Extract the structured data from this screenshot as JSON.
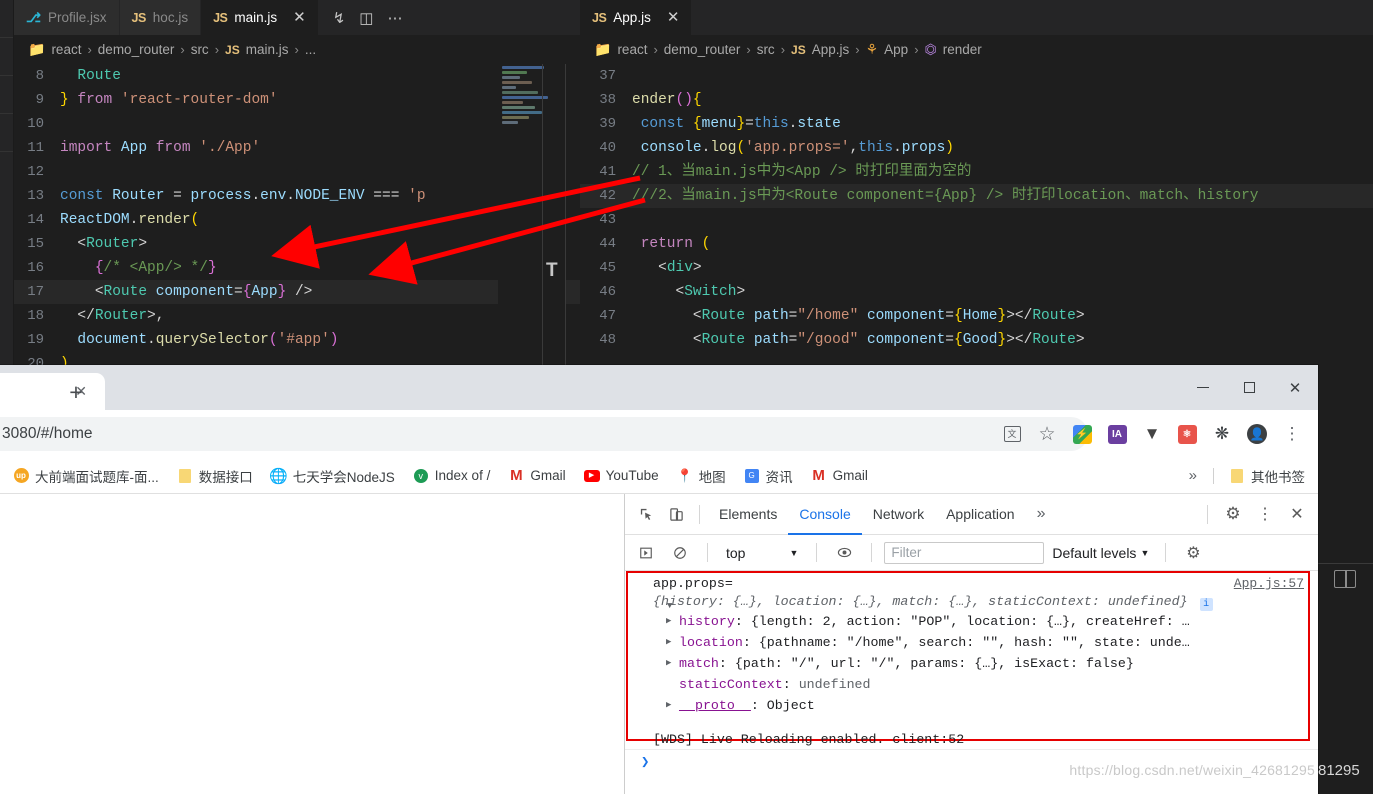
{
  "vscode": {
    "left_tabs": [
      {
        "icon": "jsx-icon",
        "icon_text": "⎇",
        "label": "Profile.jsx",
        "active": false
      },
      {
        "icon": "js-icon",
        "icon_text": "JS",
        "label": "hoc.js",
        "active": false
      },
      {
        "icon": "js-icon",
        "icon_text": "JS",
        "label": "main.js",
        "active": true,
        "close": "✕"
      }
    ],
    "left_tab_actions": [
      "source-control-icon",
      "split-editor-icon",
      "more-actions-icon"
    ],
    "left_breadcrumb": [
      "react",
      "demo_router",
      "src",
      "main.js",
      "..."
    ],
    "right_tabs": [
      {
        "icon": "js-icon",
        "icon_text": "JS",
        "label": "App.js",
        "active": true,
        "close": "✕"
      }
    ],
    "right_breadcrumb": [
      "react",
      "demo_router",
      "src",
      "App.js",
      "App",
      "render"
    ],
    "left_code": [
      {
        "n": "8",
        "tokens": [
          {
            "c": "t-tag",
            "t": "  Route"
          }
        ]
      },
      {
        "n": "9",
        "tokens": [
          {
            "c": "t-brace-y",
            "t": "} "
          },
          {
            "c": "t-key",
            "t": "from"
          },
          {
            "c": "t-str",
            "t": " 'react-router-dom'"
          }
        ]
      },
      {
        "n": "10",
        "tokens": [
          {
            "c": "t-plain",
            "t": ""
          }
        ]
      },
      {
        "n": "11",
        "tokens": [
          {
            "c": "t-key",
            "t": "import"
          },
          {
            "c": "t-var",
            "t": " App "
          },
          {
            "c": "t-key",
            "t": "from"
          },
          {
            "c": "t-str",
            "t": " './App'"
          }
        ]
      },
      {
        "n": "12",
        "tokens": [
          {
            "c": "t-plain",
            "t": ""
          }
        ]
      },
      {
        "n": "13",
        "tokens": [
          {
            "c": "t-kw2",
            "t": "const"
          },
          {
            "c": "t-var",
            "t": " Router "
          },
          {
            "c": "t-plain",
            "t": "= "
          },
          {
            "c": "t-var",
            "t": "process"
          },
          {
            "c": "t-plain",
            "t": "."
          },
          {
            "c": "t-var",
            "t": "env"
          },
          {
            "c": "t-plain",
            "t": "."
          },
          {
            "c": "t-var",
            "t": "NODE_ENV"
          },
          {
            "c": "t-plain",
            "t": " === "
          },
          {
            "c": "t-str",
            "t": "'p"
          }
        ]
      },
      {
        "n": "14",
        "tokens": [
          {
            "c": "t-var",
            "t": "ReactDOM"
          },
          {
            "c": "t-plain",
            "t": "."
          },
          {
            "c": "t-fn",
            "t": "render"
          },
          {
            "c": "t-brace-y",
            "t": "("
          }
        ]
      },
      {
        "n": "15",
        "tokens": [
          {
            "c": "t-plain",
            "t": "  "
          },
          {
            "c": "t-punc",
            "t": "<"
          },
          {
            "c": "t-tag",
            "t": "Router"
          },
          {
            "c": "t-punc",
            "t": ">"
          }
        ]
      },
      {
        "n": "16",
        "tokens": [
          {
            "c": "t-plain",
            "t": "    "
          },
          {
            "c": "t-brace-p",
            "t": "{"
          },
          {
            "c": "t-com",
            "t": "/* <App/> */"
          },
          {
            "c": "t-brace-p",
            "t": "}"
          }
        ]
      },
      {
        "n": "17",
        "tokens": [
          {
            "c": "t-plain",
            "t": "    "
          },
          {
            "c": "t-punc",
            "t": "<"
          },
          {
            "c": "t-tag",
            "t": "Route"
          },
          {
            "c": "t-var",
            "t": " component"
          },
          {
            "c": "t-plain",
            "t": "="
          },
          {
            "c": "t-brace-p",
            "t": "{"
          },
          {
            "c": "t-var",
            "t": "App"
          },
          {
            "c": "t-brace-p",
            "t": "}"
          },
          {
            "c": "t-punc",
            "t": " />"
          }
        ],
        "hl": true
      },
      {
        "n": "18",
        "tokens": [
          {
            "c": "t-plain",
            "t": "  "
          },
          {
            "c": "t-punc",
            "t": "</"
          },
          {
            "c": "t-tag",
            "t": "Router"
          },
          {
            "c": "t-punc",
            "t": ">,"
          }
        ]
      },
      {
        "n": "19",
        "tokens": [
          {
            "c": "t-plain",
            "t": "  "
          },
          {
            "c": "t-var",
            "t": "document"
          },
          {
            "c": "t-plain",
            "t": "."
          },
          {
            "c": "t-fn",
            "t": "querySelector"
          },
          {
            "c": "t-brace-p",
            "t": "("
          },
          {
            "c": "t-str",
            "t": "'#app'"
          },
          {
            "c": "t-brace-p",
            "t": ")"
          }
        ]
      },
      {
        "n": "20",
        "tokens": [
          {
            "c": "t-brace-y",
            "t": ")"
          }
        ]
      }
    ],
    "right_code": [
      {
        "n": "37",
        "tokens": [
          {
            "c": "t-plain",
            "t": ""
          }
        ]
      },
      {
        "n": "38",
        "tokens": [
          {
            "c": "t-fn",
            "t": "ender"
          },
          {
            "c": "t-brace-p",
            "t": "()"
          },
          {
            "c": "t-brace-y",
            "t": "{"
          }
        ]
      },
      {
        "n": "39",
        "tokens": [
          {
            "c": "t-plain",
            "t": " "
          },
          {
            "c": "t-kw2",
            "t": "const"
          },
          {
            "c": "t-brace-y",
            "t": " {"
          },
          {
            "c": "t-var",
            "t": "menu"
          },
          {
            "c": "t-brace-y",
            "t": "}"
          },
          {
            "c": "t-plain",
            "t": "="
          },
          {
            "c": "t-kw2",
            "t": "this"
          },
          {
            "c": "t-plain",
            "t": "."
          },
          {
            "c": "t-var",
            "t": "state"
          }
        ]
      },
      {
        "n": "40",
        "tokens": [
          {
            "c": "t-plain",
            "t": " "
          },
          {
            "c": "t-var",
            "t": "console"
          },
          {
            "c": "t-plain",
            "t": "."
          },
          {
            "c": "t-fn",
            "t": "log"
          },
          {
            "c": "t-brace-y",
            "t": "("
          },
          {
            "c": "t-str",
            "t": "'app.props='"
          },
          {
            "c": "t-plain",
            "t": ","
          },
          {
            "c": "t-kw2",
            "t": "this"
          },
          {
            "c": "t-plain",
            "t": "."
          },
          {
            "c": "t-var",
            "t": "props"
          },
          {
            "c": "t-brace-y",
            "t": ")"
          }
        ]
      },
      {
        "n": "41",
        "tokens": [
          {
            "c": "t-com",
            "t": "// 1、当main.js中为<App /> 时打印里面为空的"
          }
        ]
      },
      {
        "n": "42",
        "tokens": [
          {
            "c": "t-com",
            "t": "///2、当main.js中为<Route component={App} /> 时打印location、match、history"
          }
        ],
        "hl": true
      },
      {
        "n": "43",
        "tokens": [
          {
            "c": "t-plain",
            "t": ""
          }
        ]
      },
      {
        "n": "44",
        "tokens": [
          {
            "c": "t-plain",
            "t": " "
          },
          {
            "c": "t-key",
            "t": "return"
          },
          {
            "c": "t-brace-y",
            "t": " ("
          }
        ]
      },
      {
        "n": "45",
        "tokens": [
          {
            "c": "t-plain",
            "t": "   "
          },
          {
            "c": "t-punc",
            "t": "<"
          },
          {
            "c": "t-tag",
            "t": "div"
          },
          {
            "c": "t-punc",
            "t": ">"
          }
        ]
      },
      {
        "n": "46",
        "tokens": [
          {
            "c": "t-plain",
            "t": "     "
          },
          {
            "c": "t-punc",
            "t": "<"
          },
          {
            "c": "t-tag",
            "t": "Switch"
          },
          {
            "c": "t-punc",
            "t": ">"
          }
        ]
      },
      {
        "n": "47",
        "tokens": [
          {
            "c": "t-plain",
            "t": "       "
          },
          {
            "c": "t-punc",
            "t": "<"
          },
          {
            "c": "t-tag",
            "t": "Route"
          },
          {
            "c": "t-var",
            "t": " path"
          },
          {
            "c": "t-plain",
            "t": "="
          },
          {
            "c": "t-str",
            "t": "\"/home\""
          },
          {
            "c": "t-var",
            "t": " component"
          },
          {
            "c": "t-plain",
            "t": "="
          },
          {
            "c": "t-brace-y",
            "t": "{"
          },
          {
            "c": "t-var",
            "t": "Home"
          },
          {
            "c": "t-brace-y",
            "t": "}"
          },
          {
            "c": "t-punc",
            "t": "></"
          },
          {
            "c": "t-tag",
            "t": "Route"
          },
          {
            "c": "t-punc",
            "t": ">"
          }
        ]
      },
      {
        "n": "48",
        "tokens": [
          {
            "c": "t-plain",
            "t": "       "
          },
          {
            "c": "t-punc",
            "t": "<"
          },
          {
            "c": "t-tag",
            "t": "Route"
          },
          {
            "c": "t-var",
            "t": " path"
          },
          {
            "c": "t-plain",
            "t": "="
          },
          {
            "c": "t-str",
            "t": "\"/good\""
          },
          {
            "c": "t-var",
            "t": " component"
          },
          {
            "c": "t-plain",
            "t": "="
          },
          {
            "c": "t-brace-y",
            "t": "{"
          },
          {
            "c": "t-var",
            "t": "Good"
          },
          {
            "c": "t-brace-y",
            "t": "}"
          },
          {
            "c": "t-punc",
            "t": "></"
          },
          {
            "c": "t-tag",
            "t": "Route"
          },
          {
            "c": "t-punc",
            "t": ">"
          }
        ]
      }
    ],
    "minimap_marker": "T"
  },
  "chrome": {
    "tab_close": "✕",
    "new_tab": "+",
    "window_controls": {
      "minimize": "minimize-icon",
      "maximize": "maximize-icon",
      "close": "✕"
    },
    "url": "3080/#/home",
    "toolbar_icons": [
      "translate-icon",
      "bookmark-star-icon",
      "extension-colorful-icon",
      "ia-extension-icon",
      "v-extension-icon",
      "react-devtools-icon",
      "extensions-puzzle-icon",
      "profile-avatar-icon",
      "chrome-menu-icon"
    ],
    "bookmarks": [
      {
        "icon": "up-favicon",
        "glyph": "up",
        "label": "大前端面试题库-面..."
      },
      {
        "icon": "folder-icon",
        "glyph": "▮",
        "label": "数据接口"
      },
      {
        "icon": "globe-icon",
        "glyph": "⊕",
        "label": "七天学会NodeJS"
      },
      {
        "icon": "v-favicon",
        "glyph": "v",
        "label": "Index of /"
      },
      {
        "icon": "gmail-icon",
        "glyph": "M",
        "label": "Gmail"
      },
      {
        "icon": "youtube-icon",
        "glyph": "▶",
        "label": "YouTube"
      },
      {
        "icon": "maps-icon",
        "glyph": "📍",
        "label": "地图"
      },
      {
        "icon": "news-icon",
        "glyph": "📰",
        "label": "资讯"
      },
      {
        "icon": "gmail-icon",
        "glyph": "M",
        "label": "Gmail"
      }
    ],
    "bookmarks_overflow": "»",
    "other_bookmarks": {
      "icon": "folder-icon",
      "label": "其他书签"
    }
  },
  "devtools": {
    "left_buttons": [
      "inspect-element-icon",
      "device-toolbar-icon"
    ],
    "tabs": [
      "Elements",
      "Console",
      "Network",
      "Application"
    ],
    "active_tab": "Console",
    "overflow": "»",
    "right_buttons": [
      "settings-gear-icon",
      "more-options-icon",
      "close-devtools-icon"
    ],
    "filterbar": {
      "execute_icon": "execute-sidebar-icon",
      "clear_icon": "clear-console-icon",
      "context": "top",
      "context_caret": "▼",
      "eye_icon": "live-expression-icon",
      "filter_placeholder": "Filter",
      "levels": "Default levels",
      "levels_caret": "▼",
      "settings_icon": "console-settings-icon"
    },
    "console": {
      "highlight_color": "#e60000",
      "entries": [
        {
          "label": "app.props=",
          "source": "App.js:57",
          "summary": "{history: {…}, location: {…}, match: {…}, staticContext: undefined}",
          "info_badge": "i",
          "props": [
            {
              "key": "history",
              "sep": ": ",
              "value": "{length: 2, action: \"POP\", location: {…}, createHref: …",
              "expandable": true
            },
            {
              "key": "location",
              "sep": ": ",
              "value": "{pathname: \"/home\", search: \"\", hash: \"\", state: unde…",
              "expandable": true
            },
            {
              "key": "match",
              "sep": ": ",
              "value": "{path: \"/\", url: \"/\", params: {…}, isExact: false}",
              "expandable": true
            },
            {
              "key": "staticContext",
              "sep": ": ",
              "value": "undefined",
              "expandable": false
            },
            {
              "key": "__proto__",
              "sep": ": ",
              "value": "Object",
              "expandable": true
            }
          ]
        }
      ],
      "wds_message": "[WDS] Live Reloading enabled.",
      "wds_source": "client:52",
      "prompt": "❯"
    }
  },
  "watermark": "https://blog.csdn.net/weixin_42681295",
  "watermark_overlay": "81295"
}
